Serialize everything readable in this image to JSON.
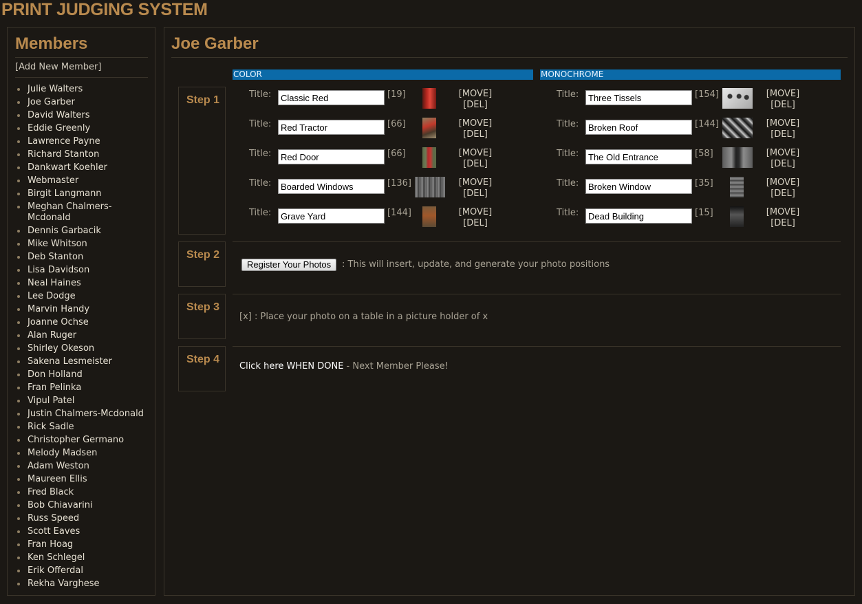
{
  "app_title": "PRINT JUDGING SYSTEM",
  "sidebar": {
    "heading": "Members",
    "add_member": "[Add New Member]",
    "members": [
      "Julie Walters",
      "Joe Garber",
      "David Walters",
      "Eddie Greenly",
      "Lawrence Payne",
      "Richard Stanton",
      "Dankwart Koehler",
      "Webmaster",
      "Birgit Langmann",
      "Meghan Chalmers-Mcdonald",
      "Dennis Garbacik",
      "Mike Whitson",
      "Deb Stanton",
      "Lisa Davidson",
      "Neal Haines",
      "Lee Dodge",
      "Marvin Handy",
      "Joanne Ochse",
      "Alan Ruger",
      "Shirley Okeson",
      "Sakena Lesmeister",
      "Don Holland",
      "Fran Pelinka",
      "Vipul Patel",
      "Justin Chalmers-Mcdonald",
      "Rick Sadle",
      "Christopher Germano",
      "Melody Madsen",
      "Adam Weston",
      "Maureen Ellis",
      "Fred Black",
      "Bob Chiavarini",
      "Russ Speed",
      "Scott Eaves",
      "Fran Hoag",
      "Ken Schlegel",
      "Erik Offerdal",
      "Rekha Varghese"
    ]
  },
  "main": {
    "member_name": "Joe Garber",
    "steps": [
      {
        "label": "Step 1"
      },
      {
        "label": "Step 2"
      },
      {
        "label": "Step 3"
      },
      {
        "label": "Step 4"
      }
    ],
    "title_label": "Title:",
    "move_label": "[MOVE]",
    "del_label": "[DEL]",
    "color": {
      "header": "COLOR",
      "photos": [
        {
          "title": "Classic Red",
          "count": "[19]",
          "thumb": "red-phonebooth"
        },
        {
          "title": "Red Tractor",
          "count": "[66]",
          "thumb": "red-tractor"
        },
        {
          "title": "Red Door",
          "count": "[66]",
          "thumb": "red-door"
        },
        {
          "title": "Boarded Windows",
          "count": "[136]",
          "thumb": "boarded-windows"
        },
        {
          "title": "Grave Yard",
          "count": "[144]",
          "thumb": "graveyard"
        }
      ]
    },
    "monochrome": {
      "header": "MONOCHROME",
      "photos": [
        {
          "title": "Three Tissels",
          "count": "[154]",
          "thumb": "tissels"
        },
        {
          "title": "Broken Roof",
          "count": "[144]",
          "thumb": "broken-roof"
        },
        {
          "title": "The Old Entrance",
          "count": "[58]",
          "thumb": "old-entrance"
        },
        {
          "title": "Broken Window",
          "count": "[35]",
          "thumb": "broken-window"
        },
        {
          "title": "Dead Building",
          "count": "[15]",
          "thumb": "dead-building"
        }
      ]
    },
    "step2": {
      "button": "Register Your Photos",
      "text": ": This will insert, update, and generate your photo positions"
    },
    "step3": {
      "text": "[x] : Place your photo on a table in a picture holder of x"
    },
    "step4": {
      "link": "Click here WHEN DONE",
      "text": " - Next Member Please!"
    }
  }
}
